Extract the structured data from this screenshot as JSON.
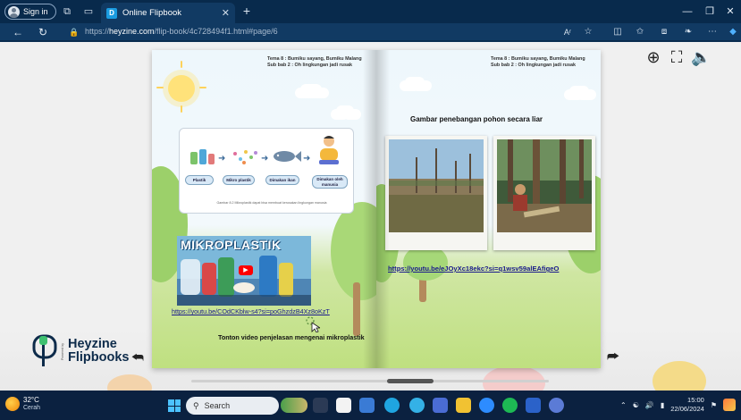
{
  "browser": {
    "signin_label": "Sign in",
    "tab_title": "Online Flipbook",
    "tab_favicon": "D",
    "url_scheme": "https://",
    "url_host": "heyzine.com",
    "url_path": "/flip-book/4c728494f1.html#page/6",
    "read_aloud_label": "Aʳ",
    "icons": [
      "workspaces-icon",
      "tab-actions-icon",
      "back-icon",
      "refresh-icon",
      "lock-icon",
      "read-aloud-icon",
      "favorite-icon",
      "split-screen-icon",
      "favorites-bar-icon",
      "collections-icon",
      "extensions-icon",
      "more-icon",
      "copilot-icon",
      "minimize-icon",
      "restore-icon",
      "close-icon"
    ]
  },
  "left_page": {
    "header_line1": "Tema 8 : Bumiku sayang, Bumiku Malang",
    "header_line2": "Sub bab 2 : Oh lingkungan jadi rusak",
    "infographic": {
      "items": [
        "Plastik",
        "Mikro plastik",
        "Dimakan ikan",
        "Dimakan oleh manusia"
      ],
      "caption": "Gambar 8.2 Mikroplastik dapat bisa membuat kerusakan lingkungan manusia"
    },
    "video_title": "MIKROPLASTIK",
    "link": "https://youtu.be/COdCKblw-s4?si=poGhzdzB4Xz8oKzT",
    "caption": "Tonton video penjelasan mengenai mikroplastik"
  },
  "right_page": {
    "header_line1": "Tema 8 : Bumiku sayang, Bumiku Malang",
    "header_line2": "Sub bab 2 : Oh lingkungan jadi rusak",
    "title": "Gambar penebangan pohon secara liar",
    "link": "https://youtu.be/eJOyXc18ekc?si=q1wsv59alEAfigeO"
  },
  "logo": {
    "line1": "Heyzine",
    "line2": "Flipbooks",
    "powered": "Powered by"
  },
  "viewer_controls": [
    "zoom-in-icon",
    "fullscreen-icon",
    "sound-icon",
    "prev-page-icon",
    "next-page-icon"
  ],
  "taskbar": {
    "temperature": "32°C",
    "condition": "Cerah",
    "search_placeholder": "Search",
    "time": "15:00",
    "date": "22/06/2024"
  },
  "colors": {
    "chrome_dark": "#082a4c",
    "chrome_mid": "#113a63",
    "viewer_bg": "#f0f0f0",
    "logo_navy": "#0d2b4a",
    "link_blue": "#1a1a8c"
  }
}
